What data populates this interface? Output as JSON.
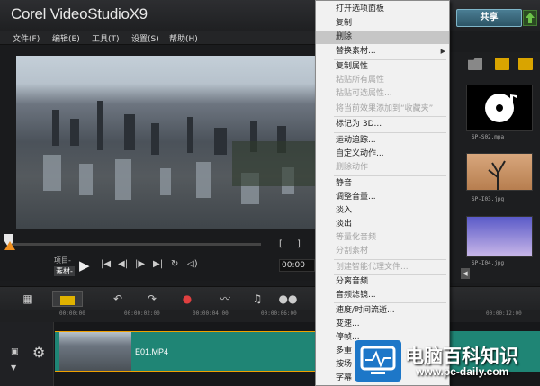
{
  "app": {
    "brand": "Corel",
    "product": "VideoStudio",
    "version": "X9"
  },
  "menubar": {
    "items": [
      "文件(F)",
      "编辑(E)",
      "工具(T)",
      "设置(S)",
      "帮助(H)"
    ]
  },
  "share": {
    "label": "共享"
  },
  "player": {
    "mode_project": "项目-",
    "mode_clip": "素材-",
    "timecode": "00:00"
  },
  "library": {
    "thumbs": [
      {
        "label": "SP-S02.mpa"
      },
      {
        "label": "SP-I03.jpg"
      },
      {
        "label": "SP-I04.jpg"
      }
    ]
  },
  "timeline": {
    "ruler": [
      "00:00:00",
      "00:00:02:00",
      "00:00:04:00",
      "00:00:06:00",
      "00:00:12:00"
    ],
    "clip_name": "E01.MP4"
  },
  "context_menu": {
    "items": [
      {
        "label": "打开选项面板",
        "disabled": false
      },
      {
        "label": "复制",
        "disabled": false
      },
      {
        "label": "删除",
        "disabled": false,
        "hover": true
      },
      {
        "label": "替换素材...",
        "disabled": false,
        "submenu": true
      },
      {
        "label": "复制属性",
        "disabled": false
      },
      {
        "label": "粘贴所有属性",
        "disabled": true
      },
      {
        "label": "粘贴可选属性...",
        "disabled": true
      },
      {
        "label": "将当前效果添加到“收藏夹”",
        "disabled": true
      },
      {
        "label": "标记为 3D...",
        "disabled": false
      },
      {
        "label": "运动追踪...",
        "disabled": false
      },
      {
        "label": "自定义动作...",
        "disabled": false
      },
      {
        "label": "删除动作",
        "disabled": true
      },
      {
        "label": "静音",
        "disabled": false
      },
      {
        "label": "调整音量...",
        "disabled": false
      },
      {
        "label": "淡入",
        "disabled": false
      },
      {
        "label": "淡出",
        "disabled": false
      },
      {
        "label": "等量化音频",
        "disabled": true
      },
      {
        "label": "分割素材",
        "disabled": true
      },
      {
        "label": "创建智能代理文件...",
        "disabled": true
      },
      {
        "label": "分离音频",
        "disabled": false
      },
      {
        "label": "音频滤镜...",
        "disabled": false
      },
      {
        "label": "速度/时间流逝...",
        "disabled": false
      },
      {
        "label": "变速...",
        "disabled": false
      },
      {
        "label": "停帧...",
        "disabled": false
      },
      {
        "label": "多重",
        "disabled": false
      },
      {
        "label": "按场",
        "disabled": false
      },
      {
        "label": "字幕",
        "disabled": false
      }
    ]
  },
  "watermark": {
    "title": "电脑百科知识",
    "url": "www.pc-daily.com"
  }
}
